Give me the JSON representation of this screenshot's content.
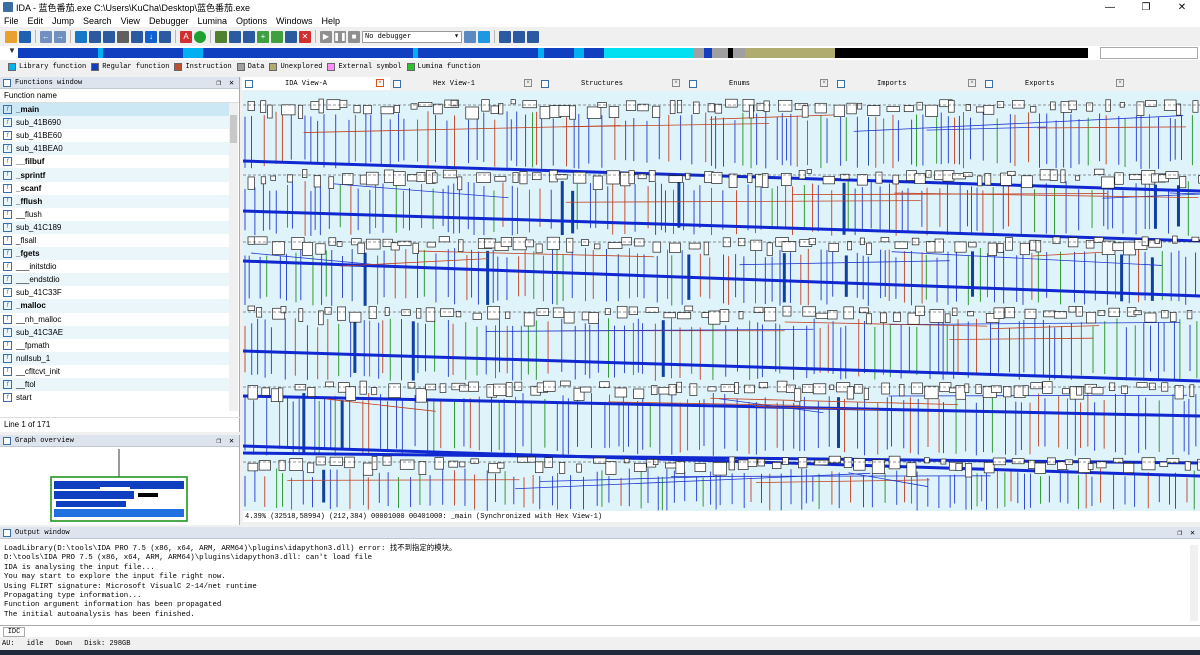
{
  "window": {
    "title": "IDA - 蓝色番茄.exe C:\\Users\\KuCha\\Desktop\\蓝色番茄.exe",
    "minimize": "—",
    "maximize": "❐",
    "close": "✕"
  },
  "menu": [
    "File",
    "Edit",
    "Jump",
    "Search",
    "View",
    "Debugger",
    "Lumina",
    "Options",
    "Windows",
    "Help"
  ],
  "toolbar": {
    "debugger_select": "No debugger"
  },
  "legend": [
    {
      "label": "Library function",
      "color": "#00b0f0"
    },
    {
      "label": "Regular function",
      "color": "#1040c0"
    },
    {
      "label": "Instruction",
      "color": "#c05030"
    },
    {
      "label": "Data",
      "color": "#a0a0a0"
    },
    {
      "label": "Unexplored",
      "color": "#b0ac70"
    },
    {
      "label": "External symbol",
      "color": "#ff90ff"
    },
    {
      "label": "Lumina function",
      "color": "#30c030"
    }
  ],
  "functions_window": {
    "title": "Functions window",
    "column": "Function name",
    "items": [
      {
        "name": "_main",
        "bold": true
      },
      {
        "name": "sub_41B690",
        "bold": false
      },
      {
        "name": "sub_41BE60",
        "bold": false
      },
      {
        "name": "sub_41BEA0",
        "bold": false
      },
      {
        "name": "__filbuf",
        "bold": true
      },
      {
        "name": "_sprintf",
        "bold": true
      },
      {
        "name": "_scanf",
        "bold": true
      },
      {
        "name": "_fflush",
        "bold": true
      },
      {
        "name": "__flush",
        "bold": false
      },
      {
        "name": "sub_41C189",
        "bold": false
      },
      {
        "name": "_flsall",
        "bold": false
      },
      {
        "name": "_fgets",
        "bold": true
      },
      {
        "name": "___initstdio",
        "bold": false
      },
      {
        "name": "___endstdio",
        "bold": false
      },
      {
        "name": "sub_41C33F",
        "bold": false
      },
      {
        "name": "_malloc",
        "bold": true
      },
      {
        "name": "__nh_malloc",
        "bold": false
      },
      {
        "name": "sub_41C3AE",
        "bold": false
      },
      {
        "name": "__fpmath",
        "bold": false
      },
      {
        "name": "nullsub_1",
        "bold": false
      },
      {
        "name": "__cfltcvt_init",
        "bold": false
      },
      {
        "name": "__ftol",
        "bold": false
      },
      {
        "name": "start",
        "bold": false
      }
    ],
    "status": "Line 1 of 171"
  },
  "graph_overview": {
    "title": "Graph overview"
  },
  "tabs": [
    {
      "label": "IDA View-A",
      "active": true
    },
    {
      "label": "Hex View-1",
      "active": false
    },
    {
      "label": "Structures",
      "active": false
    },
    {
      "label": "Enums",
      "active": false
    },
    {
      "label": "Imports",
      "active": false
    },
    {
      "label": "Exports",
      "active": false
    }
  ],
  "graph_status": "4.39% (32518,58994) (212,384) 00001000 00401000: _main (Synchronized with Hex View-1)",
  "output_window": {
    "title": "Output window",
    "lines": [
      "LoadLibrary(D:\\tools\\IDA PRO 7.5 (x86, x64, ARM, ARM64)\\plugins\\idapython3.dll) error: 找不到指定的模块。",
      "D:\\tools\\IDA PRO 7.5 (x86, x64, ARM, ARM64)\\plugins\\idapython3.dll: can't load file",
      "IDA is analysing the input file...",
      "You may start to explore the input file right now.",
      "Using FLIRT signature: Microsoft VisualC 2-14/net runtime",
      "Propagating type information...",
      "Function argument information has been propagated",
      "The initial autoanalysis has been finished."
    ]
  },
  "command": {
    "label": "IDC"
  },
  "statusbar": {
    "au": "AU:",
    "state": "idle",
    "direction": "Down",
    "disk": "Disk: 298GB"
  }
}
